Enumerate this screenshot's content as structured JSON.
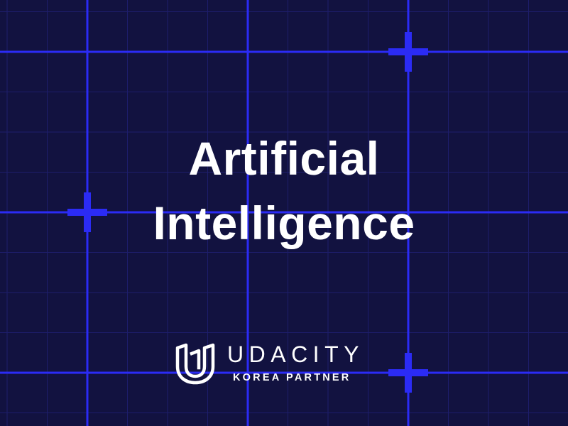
{
  "title": {
    "line1": "Artificial",
    "line2": "Intelligence"
  },
  "brand": {
    "logo_icon": "udacity-u-logo-icon",
    "name": "UDACITY",
    "subtitle": "KOREA PARTNER"
  },
  "colors": {
    "background": "#121240",
    "grid_line": "#2b2bf5",
    "text": "#ffffff"
  }
}
